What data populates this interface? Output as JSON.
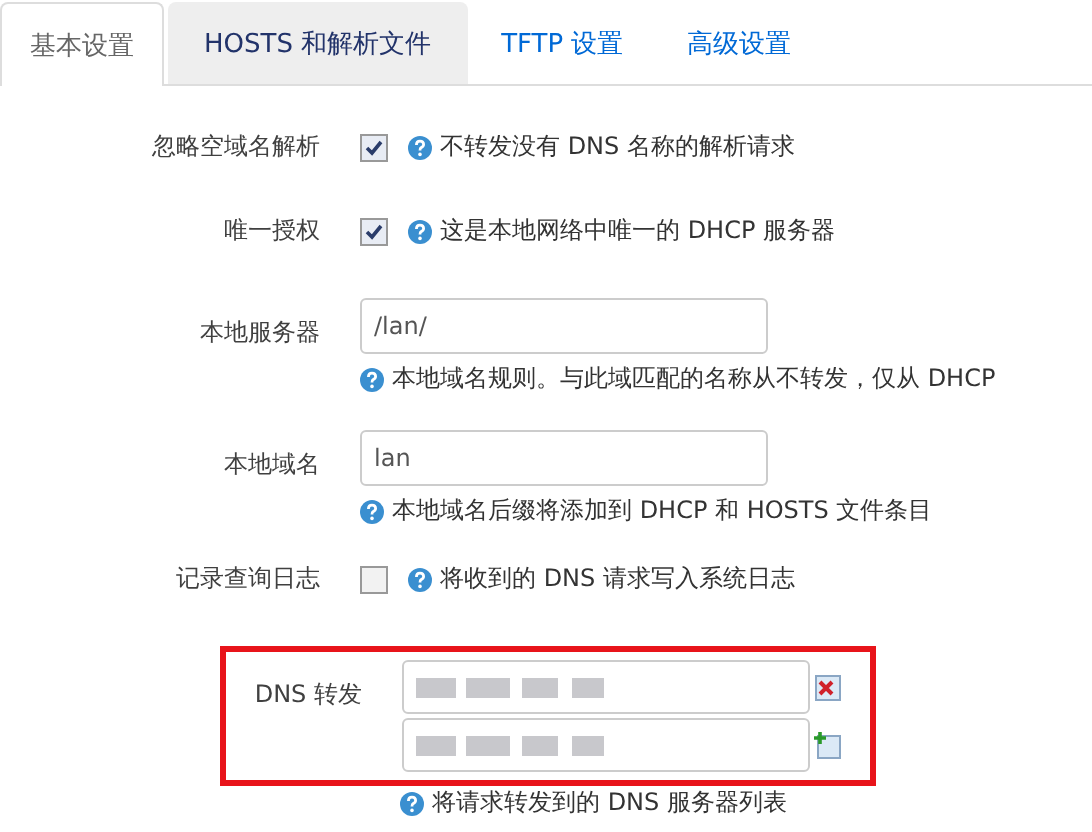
{
  "tabs": [
    {
      "label": "基本设置",
      "selected": true
    },
    {
      "label": "HOSTS 和解析文件",
      "selected": false
    },
    {
      "label": "TFTP 设置",
      "selected": false
    },
    {
      "label": "高级设置",
      "selected": false
    }
  ],
  "options": [
    {
      "kind": "checkbox",
      "label": "忽略空域名解析",
      "checked": true,
      "help": "不转发没有 DNS 名称的解析请求"
    },
    {
      "kind": "checkbox",
      "label": "唯一授权",
      "checked": true,
      "help": "这是本地网络中唯一的 DHCP 服务器"
    },
    {
      "kind": "text",
      "label": "本地服务器",
      "value": "/lan/",
      "help": "本地域名规则。与此域匹配的名称从不转发，仅从 DHCP"
    },
    {
      "kind": "text",
      "label": "本地域名",
      "value": "lan",
      "help": "本地域名后缀将添加到 DHCP 和 HOSTS 文件条目"
    },
    {
      "kind": "checkbox",
      "label": "记录查询日志",
      "checked": false,
      "help": "将收到的 DNS 请求写入系统日志"
    },
    {
      "kind": "list",
      "label": "DNS 转发",
      "highlighted": true,
      "entries": [
        {
          "removable": true
        },
        {
          "removable": false
        }
      ],
      "help": "将请求转发到的 DNS 服务器列表"
    }
  ]
}
